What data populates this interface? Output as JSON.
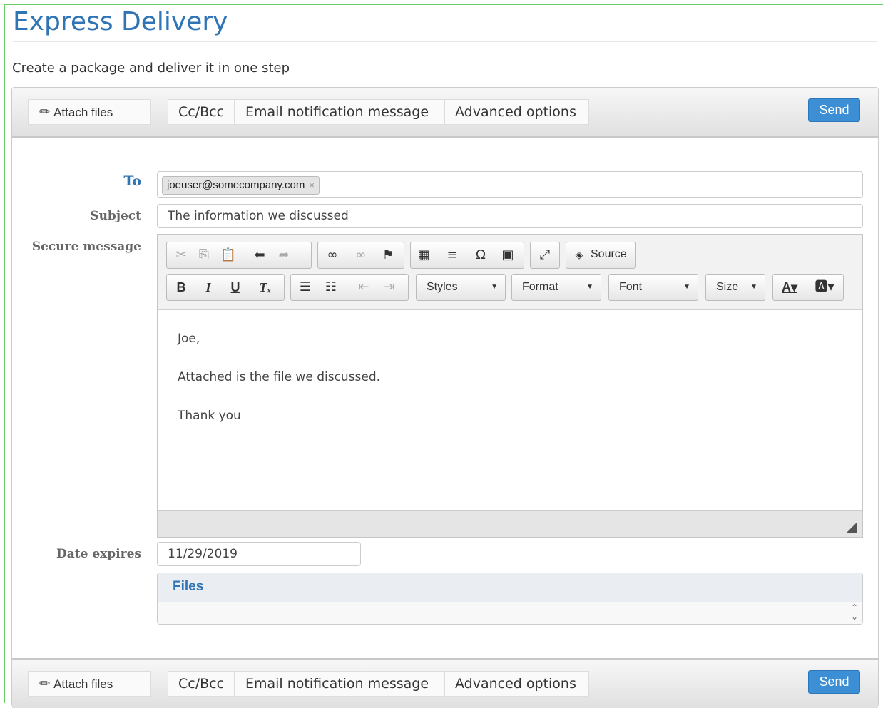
{
  "page": {
    "title": "Express Delivery",
    "subtitle": "Create a package and deliver it in one step"
  },
  "toolbar": {
    "attach_label": "Attach files",
    "ccbcc_label": "Cc/Bcc",
    "email_notification_label": "Email notification message",
    "advanced_options_label": "Advanced options",
    "send_label": "Send"
  },
  "form": {
    "to_label": "To",
    "to_recipients": [
      "joeuser@somecompany.com"
    ],
    "subject_label": "Subject",
    "subject_value": "The information we discussed",
    "message_label": "Secure message",
    "date_label": "Date expires",
    "date_value": "11/29/2019",
    "files_label": "Files"
  },
  "editor": {
    "source_label": "Source",
    "styles_label": "Styles",
    "format_label": "Format",
    "font_label": "Font",
    "size_label": "Size",
    "body_lines": [
      "Joe,",
      "Attached is the file we discussed.",
      "Thank you"
    ]
  },
  "icons": {
    "attach": "paperclip-icon",
    "cut": "cut-icon",
    "copy": "copy-icon",
    "paste": "paste-icon",
    "undo": "undo-icon",
    "redo": "redo-icon",
    "link": "link-icon",
    "unlink": "unlink-icon",
    "anchor": "flag-icon",
    "table": "table-icon",
    "hr": "horizontal-rule-icon",
    "special_char": "omega-icon",
    "image": "image-icon",
    "maximize": "maximize-icon",
    "source": "source-icon"
  },
  "colors": {
    "title": "#2f74b5",
    "send_button": "#3c8fd4",
    "frame_border": "#66cc66"
  }
}
